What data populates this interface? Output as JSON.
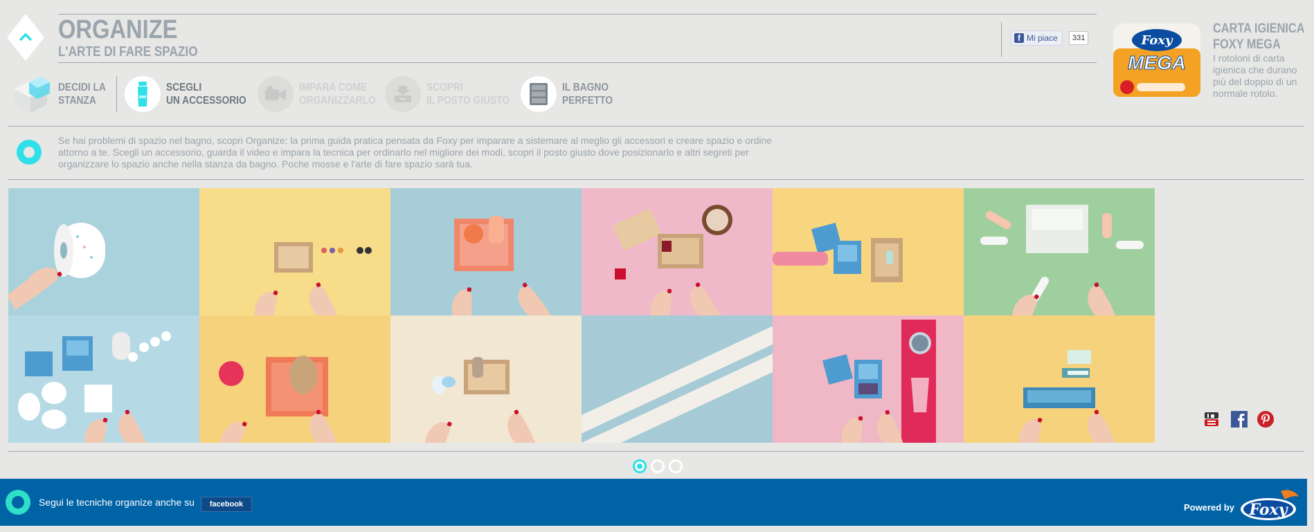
{
  "header": {
    "title": "ORGANIZE",
    "subtitle": "L'ARTE DI FARE SPAZIO",
    "up_icon": "chevron-up-icon"
  },
  "facebook": {
    "like_label": "Mi piace",
    "like_count": "331"
  },
  "product": {
    "title_line1": "CARTA IGIENICA",
    "title_line2": "FOXY MEGA",
    "description": "I rotoloni di carta igienica che durano più del doppio di un normale rotolo.",
    "pack_brand": "Foxy",
    "pack_name": "MEGA"
  },
  "steps": [
    {
      "line1": "DECIDI LA",
      "line2": "STANZA",
      "icon": "room-cube-icon",
      "state": "completed"
    },
    {
      "line1": "SCEGLI",
      "line2": "UN ACCESSORIO",
      "icon": "toothpaste-icon",
      "state": "active"
    },
    {
      "line1": "IMPARA COME",
      "line2": "ORGANIZZARLO",
      "icon": "video-camera-icon",
      "state": "disabled"
    },
    {
      "line1": "SCOPRI",
      "line2": "IL POSTO GIUSTO",
      "icon": "drawer-icon",
      "state": "disabled"
    },
    {
      "line1": "IL BAGNO",
      "line2": "PERFETTO",
      "icon": "cabinet-icon",
      "state": "available"
    }
  ],
  "intro": {
    "text": "Se hai problemi di spazio nel bagno, scopri Organize: la prima guida pratica pensata da Foxy per imparare a sistemare al meglio gli accessori e creare spazio e ordine attorno a te. Scegli un accessorio, guarda il video e impara la tecnica per ordinarlo nel migliore dei modi, scopri il posto giusto dove posizionarlo e altri segreti per organizzare lo spazio anche nella stanza da bagno. Poche mosse e l'arte di fare spazio sarà tua."
  },
  "tiles": [
    {
      "bg": "#a9d2dc",
      "subject": "toilet-roll"
    },
    {
      "bg": "#f7dc8a",
      "subject": "wooden-tray-cosmetics"
    },
    {
      "bg": "#a7cdd9",
      "subject": "orange-tray-bottles"
    },
    {
      "bg": "#f0b9c9",
      "subject": "wooden-boxes-bowl"
    },
    {
      "bg": "#f8d67f",
      "subject": "blue-box-curlers"
    },
    {
      "bg": "#9fcf9e",
      "subject": "plasters-box"
    },
    {
      "bg": "#b5dae6",
      "subject": "cotton-swabs"
    },
    {
      "bg": "#f6d27c",
      "subject": "sponge-tray"
    },
    {
      "bg": "#f1e7d2",
      "subject": "soap-box"
    },
    {
      "bg": "#a6cbd7",
      "subject": "tape-strips"
    },
    {
      "bg": "#f0b8c7",
      "subject": "towel-box"
    },
    {
      "bg": "#f6d27c",
      "subject": "blue-tray"
    }
  ],
  "social": [
    "youtube-icon",
    "facebook-icon",
    "pinterest-icon"
  ],
  "pagination": {
    "pages": 3,
    "active": 0
  },
  "footer": {
    "text": "Segui le tecniche organize anche su",
    "fb_label": "facebook",
    "powered_by": "Powered by",
    "logo_text": "Foxy"
  },
  "colors": {
    "accent": "#2fe0e8",
    "footer_bg": "#0063a6",
    "text_gray": "#9aa4ac",
    "page_bg": "#e7e7e5"
  }
}
